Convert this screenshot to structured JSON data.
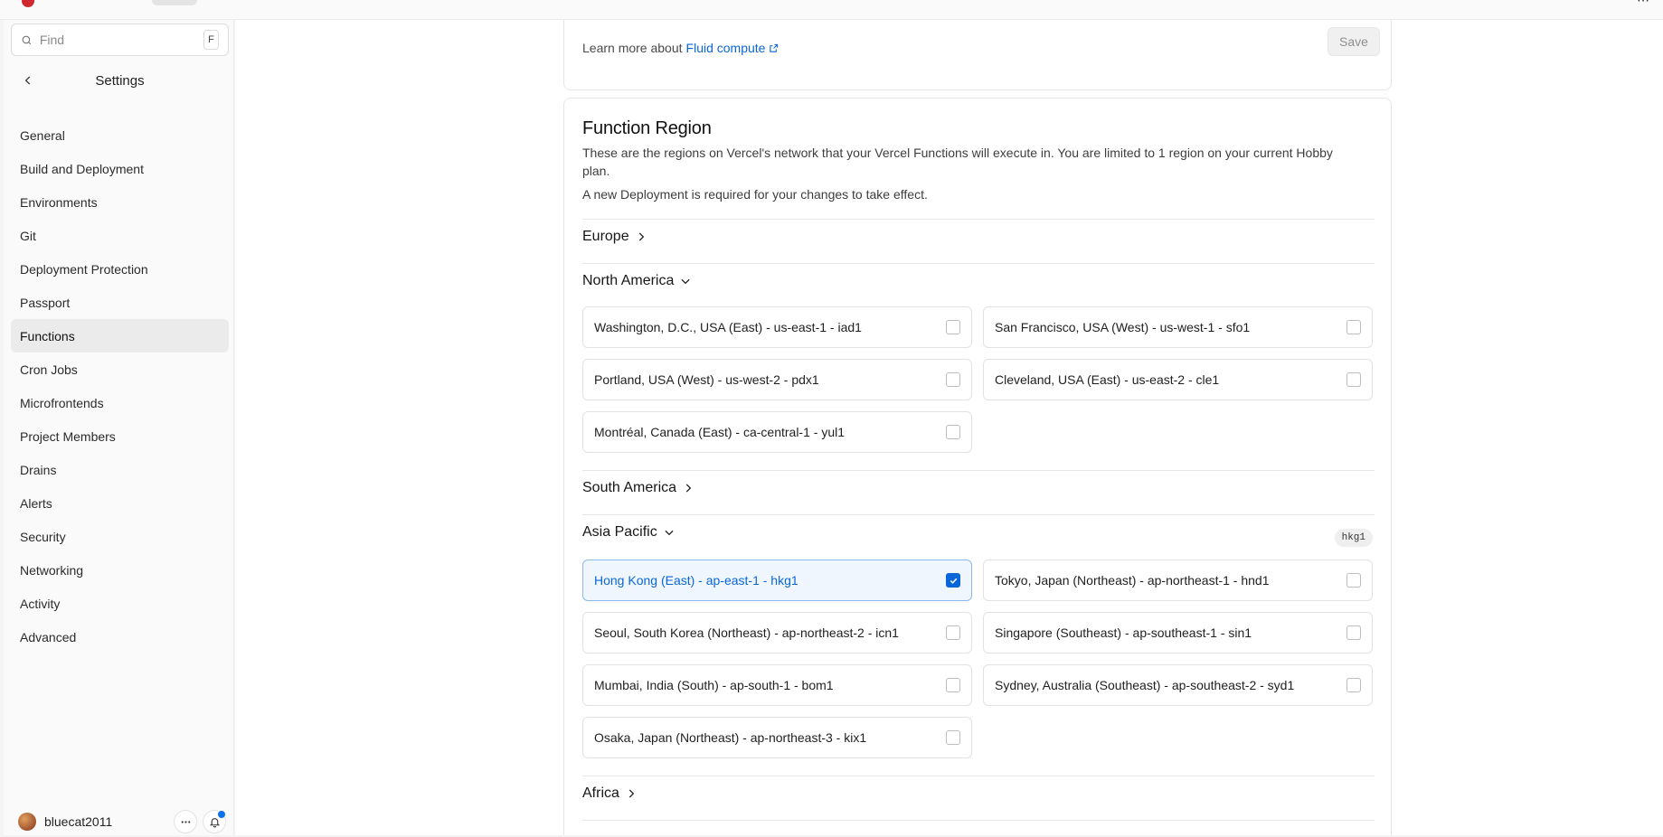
{
  "sidebar": {
    "find": {
      "placeholder": "Find",
      "shortcut": "F"
    },
    "title": "Settings",
    "items": [
      {
        "label": "General"
      },
      {
        "label": "Build and Deployment"
      },
      {
        "label": "Environments"
      },
      {
        "label": "Git"
      },
      {
        "label": "Deployment Protection"
      },
      {
        "label": "Passport"
      },
      {
        "label": "Functions"
      },
      {
        "label": "Cron Jobs"
      },
      {
        "label": "Microfrontends"
      },
      {
        "label": "Project Members"
      },
      {
        "label": "Drains"
      },
      {
        "label": "Alerts"
      },
      {
        "label": "Security"
      },
      {
        "label": "Networking"
      },
      {
        "label": "Activity"
      },
      {
        "label": "Advanced"
      }
    ],
    "active_item": "Functions",
    "user": {
      "name": "bluecat2011"
    }
  },
  "fluid": {
    "learn_prefix": "Learn more about",
    "link": "Fluid compute",
    "save_label": "Save"
  },
  "region_card": {
    "title": "Function Region",
    "description": "These are the regions on Vercel's network that your Vercel Functions will execute in. You are limited to 1 region on your current Hobby plan.",
    "note": "A new Deployment is required for your changes to take effect.",
    "sections": {
      "europe": {
        "label": "Europe",
        "expanded": false
      },
      "north_america": {
        "label": "North America",
        "expanded": true,
        "regions": [
          {
            "label": "Washington, D.C., USA (East) - us-east-1 - iad1",
            "checked": false
          },
          {
            "label": "San Francisco, USA (West) - us-west-1 - sfo1",
            "checked": false
          },
          {
            "label": "Portland, USA (West) - us-west-2 - pdx1",
            "checked": false
          },
          {
            "label": "Cleveland, USA (East) - us-east-2 - cle1",
            "checked": false
          },
          {
            "label": "Montréal, Canada (East) - ca-central-1 - yul1",
            "checked": false
          }
        ]
      },
      "south_america": {
        "label": "South America",
        "expanded": false
      },
      "asia_pacific": {
        "label": "Asia Pacific",
        "expanded": true,
        "badge": "hkg1",
        "regions": [
          {
            "label": "Hong Kong (East) - ap-east-1 - hkg1",
            "checked": true
          },
          {
            "label": "Tokyo, Japan (Northeast) - ap-northeast-1 - hnd1",
            "checked": false
          },
          {
            "label": "Seoul, South Korea (Northeast) - ap-northeast-2 - icn1",
            "checked": false
          },
          {
            "label": "Singapore (Southeast) - ap-southeast-1 - sin1",
            "checked": false
          },
          {
            "label": "Mumbai, India (South) - ap-south-1 - bom1",
            "checked": false
          },
          {
            "label": "Sydney, Australia (Southeast) - ap-southeast-2 - syd1",
            "checked": false
          },
          {
            "label": "Osaka, Japan (Northeast) - ap-northeast-3 - kix1",
            "checked": false
          }
        ]
      },
      "africa": {
        "label": "Africa",
        "expanded": false
      }
    }
  },
  "colors": {
    "accent": "#0a66d8",
    "notification": "#0a72ef",
    "selected_bg": "#f0f6fd"
  }
}
